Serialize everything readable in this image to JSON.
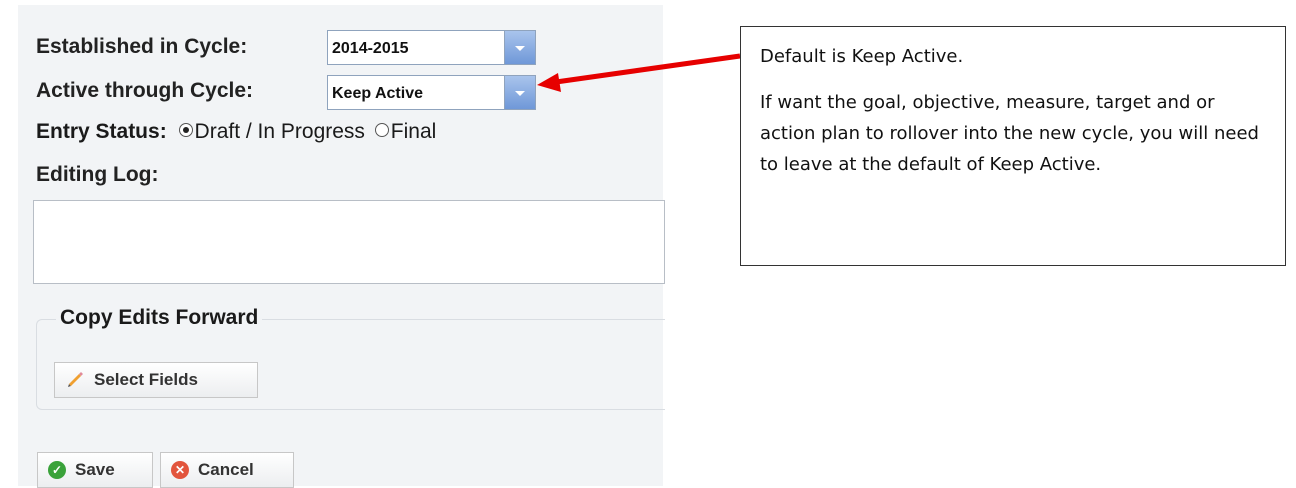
{
  "form": {
    "established_label": "Established in Cycle:",
    "established_value": "2014-2015",
    "active_label": "Active through Cycle:",
    "active_value": "Keep Active",
    "entry_status_label": "Entry Status:",
    "entry_status_options": [
      "Draft / In Progress",
      "Final"
    ],
    "entry_status_selected": "Draft / In Progress",
    "editing_log_label": "Editing Log:",
    "editing_log_value": "",
    "copy_edits_label": "Copy Edits Forward",
    "select_fields_label": "Select Fields",
    "save_label": "Save",
    "cancel_label": "Cancel"
  },
  "icons": {
    "select_fields": "pencil-icon",
    "save": "check-circle-icon",
    "cancel": "x-circle-icon"
  },
  "colors": {
    "arrow": "#e60000",
    "save_icon": "#3aa23a",
    "cancel_icon": "#e2553d",
    "pencil": "#f0a030"
  },
  "callout": {
    "line1": "Default is Keep Active.",
    "line2": "If want the goal, objective, measure, target and or action plan to rollover into the new cycle, you will need to leave at the default of Keep Active."
  }
}
